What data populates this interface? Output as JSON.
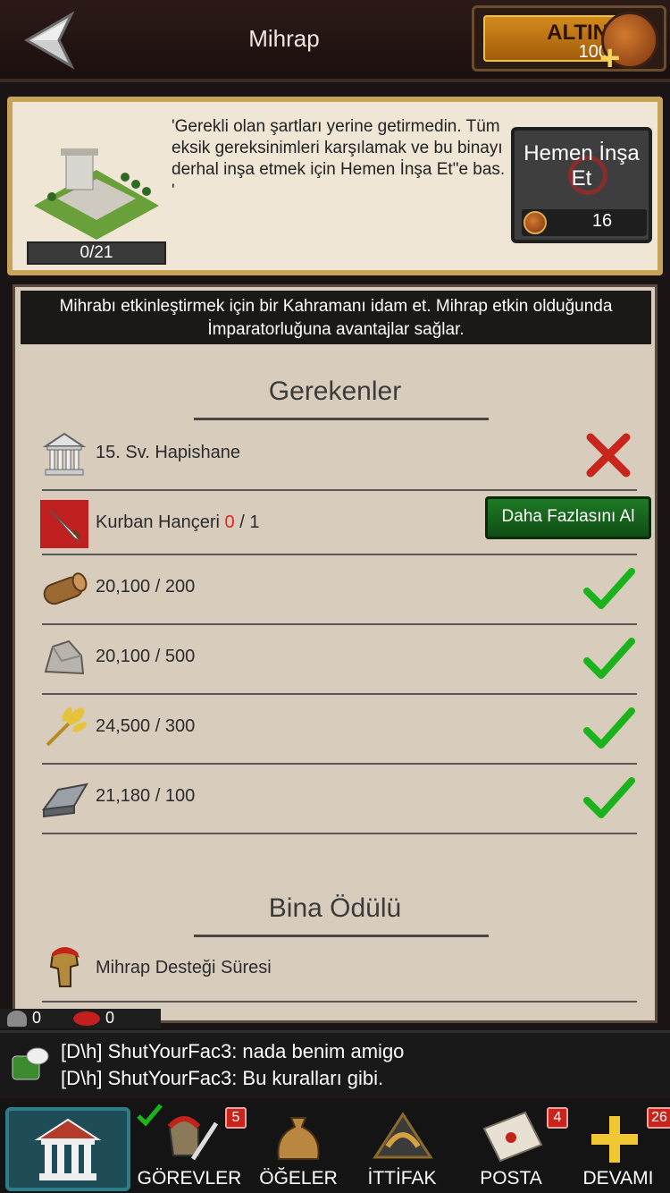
{
  "header": {
    "title": "Mihrap",
    "gold_label": "ALTIN",
    "gold_value": "100"
  },
  "info": {
    "progress": "0/21",
    "message": "'Gerekli olan şartları yerine getirmedin. Tüm eksik gereksinimleri karşılamak ve bu binayı derhal inşa etmek için Hemen İnşa Et\"e bas. '",
    "build_now_label": "Hemen İnşa Et",
    "build_now_cost": "16"
  },
  "description": "Mihrabı etkinleştirmek için bir Kahramanı idam et. Mihrap etkin olduğunda İmparatorluğuna avantajlar sağlar.",
  "requirements": {
    "title": "Gerekenler",
    "items": [
      {
        "label": "15. Sv. Hapishane",
        "status": "missing"
      },
      {
        "label": "Kurban Hançeri",
        "count_have": "0",
        "count_need": "/ 1",
        "button": "Daha Fazlasını Al"
      },
      {
        "label": "20,100 / 200",
        "status": "ok"
      },
      {
        "label": "20,100 / 500",
        "status": "ok"
      },
      {
        "label": "24,500 / 300",
        "status": "ok"
      },
      {
        "label": "21,180 / 100",
        "status": "ok"
      }
    ]
  },
  "reward": {
    "title": "Bina Ödülü",
    "items": [
      {
        "label": "Mihrap Desteği Süresi"
      }
    ]
  },
  "status_counts": {
    "users": "0",
    "messages": "0"
  },
  "chat": {
    "lines": [
      "[D\\h] ShutYourFac3: nada benim amigo",
      "[D\\h] ShutYourFac3: Bu kuralları gibi."
    ]
  },
  "nav": {
    "items": [
      {
        "label": "GÖREVLER",
        "badge": "5"
      },
      {
        "label": "ÖĞELER",
        "badge": ""
      },
      {
        "label": "İTTİFAK",
        "badge": ""
      },
      {
        "label": "POSTA",
        "badge": "4"
      },
      {
        "label": "DEVAMI",
        "badge": "26"
      }
    ]
  },
  "colors": {
    "accent": "#c7a45a",
    "ok": "#1bb31b",
    "missing": "#c8261c",
    "button": "#1f7a25"
  }
}
